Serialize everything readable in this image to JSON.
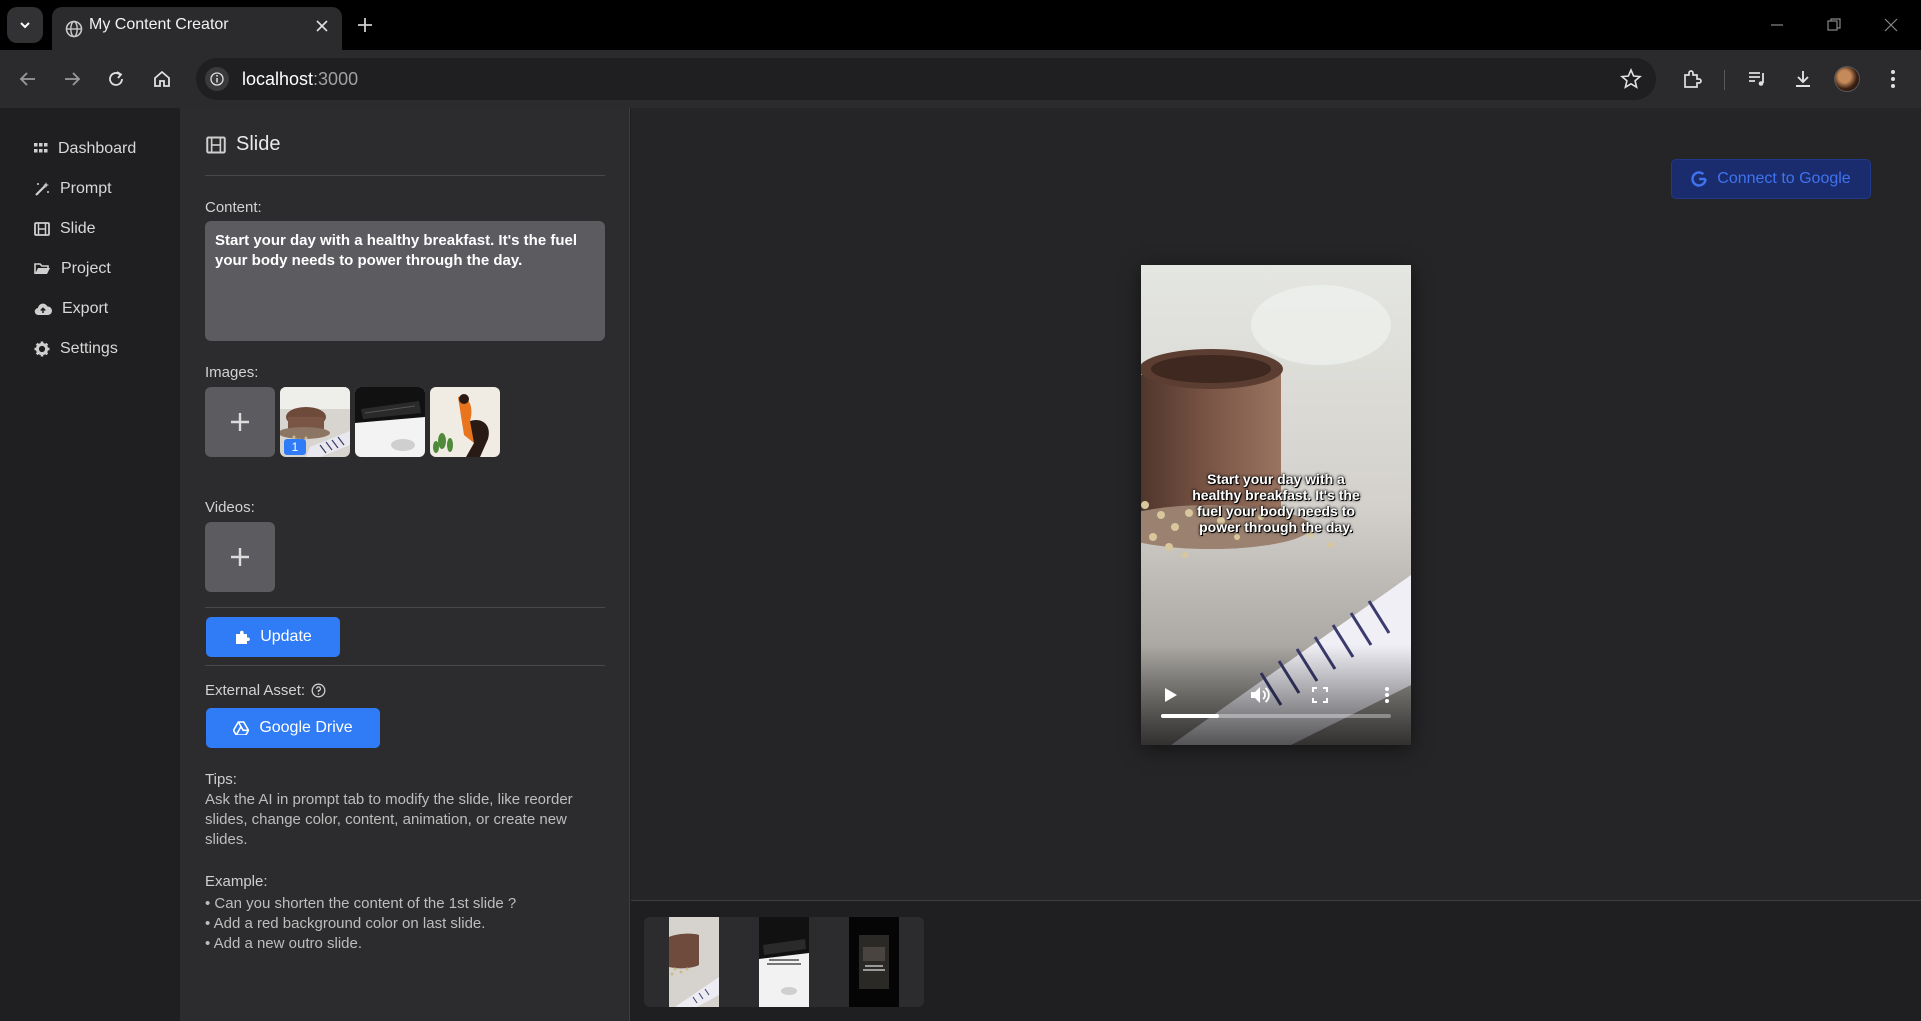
{
  "browser": {
    "tab_title": "My Content Creator",
    "url_host": "localhost",
    "url_port": ":3000"
  },
  "sidebar": {
    "items": [
      {
        "label": "Dashboard",
        "icon": "grid-icon"
      },
      {
        "label": "Prompt",
        "icon": "magic-wand-icon"
      },
      {
        "label": "Slide",
        "icon": "film-icon"
      },
      {
        "label": "Project",
        "icon": "folder-open-icon"
      },
      {
        "label": "Export",
        "icon": "cloud-upload-icon"
      },
      {
        "label": "Settings",
        "icon": "gear-icon"
      }
    ]
  },
  "panel": {
    "title": "Slide",
    "content_label": "Content:",
    "content_value": "Start your day with a healthy breakfast. It's the fuel your body needs to power through the day.",
    "images_label": "Images:",
    "image_badge": "1",
    "videos_label": "Videos:",
    "update_label": "Update",
    "external_asset_label": "External Asset:",
    "google_drive_label": "Google Drive",
    "tips_title": "Tips:",
    "tips_text": "Ask the AI in prompt tab to modify the slide, like reorder slides, change color, content, animation, or create new slides.",
    "example_title": "Example:",
    "examples": [
      "• Can you shorten the content of the 1st slide ?",
      "• Add a red background color on last slide.",
      "• Add a new outro slide."
    ]
  },
  "main": {
    "connect_label": "Connect to Google",
    "video_caption": "Start your day with a healthy breakfast. It's the fuel your body needs to power through the day.",
    "video_progress": 0.25
  },
  "colors": {
    "accent": "#2f7cf6",
    "connect_bg": "#1a2c6e",
    "connect_text": "#3f73ef"
  }
}
